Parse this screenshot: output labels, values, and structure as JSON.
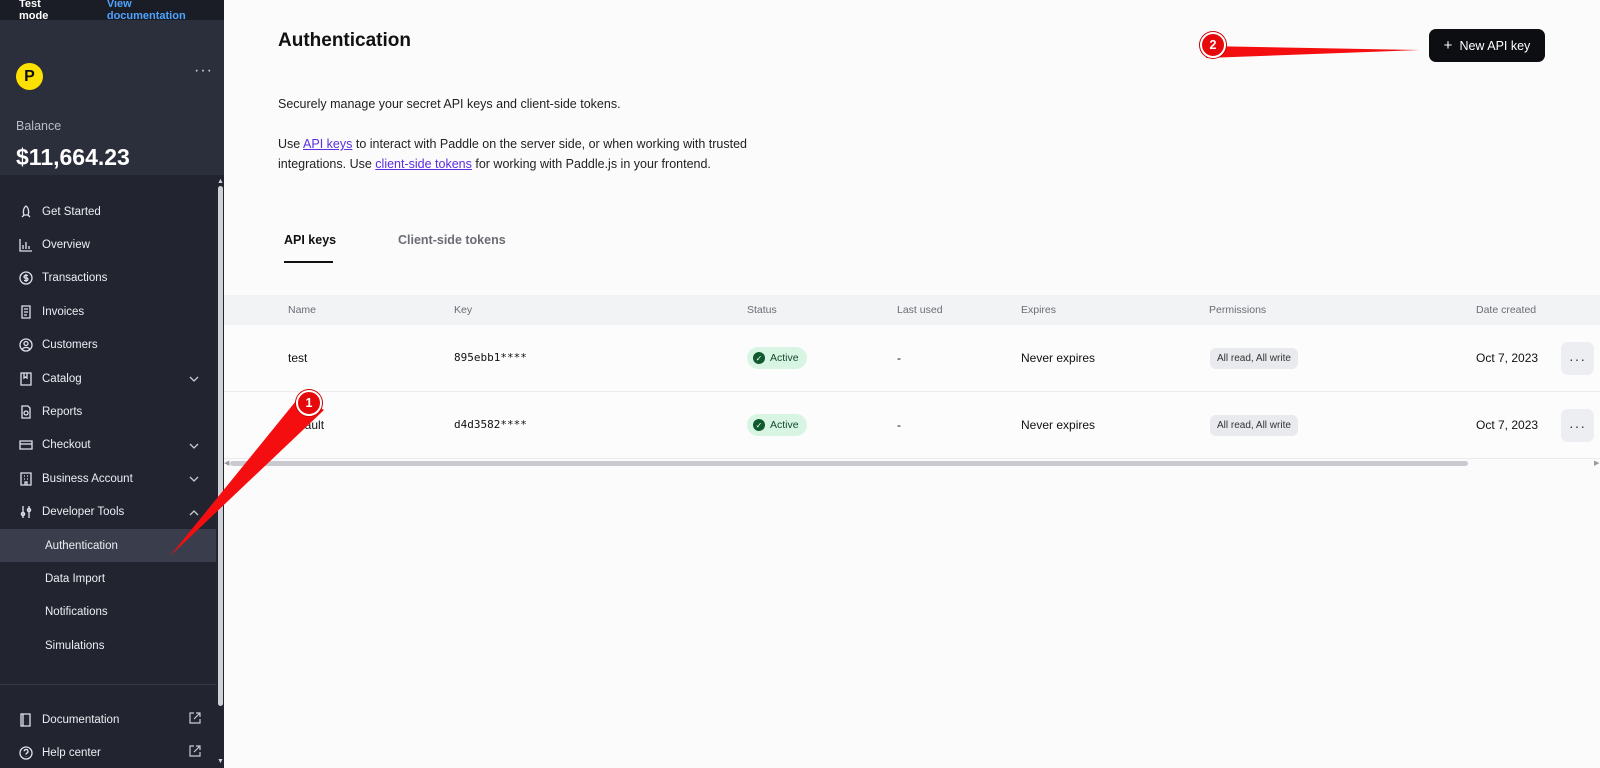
{
  "topbar": {
    "mode": "Test mode",
    "doc_link": "View documentation"
  },
  "brand": {
    "logo_letter": "P",
    "menu": "···",
    "balance_label": "Balance",
    "balance_value": "$11,664.23"
  },
  "sidebar": {
    "items": [
      {
        "label": "Get Started",
        "icon": "rocket-icon"
      },
      {
        "label": "Overview",
        "icon": "chart-icon"
      },
      {
        "label": "Transactions",
        "icon": "dollar-icon"
      },
      {
        "label": "Invoices",
        "icon": "invoice-icon"
      },
      {
        "label": "Customers",
        "icon": "user-icon"
      },
      {
        "label": "Catalog",
        "icon": "catalog-icon"
      },
      {
        "label": "Reports",
        "icon": "report-icon"
      },
      {
        "label": "Checkout",
        "icon": "card-icon"
      },
      {
        "label": "Business Account",
        "icon": "building-icon"
      },
      {
        "label": "Developer Tools",
        "icon": "sliders-icon"
      }
    ],
    "sub_items": [
      "Authentication",
      "Data Import",
      "Notifications",
      "Simulations"
    ],
    "bottom": [
      {
        "label": "Documentation",
        "icon": "book-icon"
      },
      {
        "label": "Help center",
        "icon": "help-icon"
      }
    ]
  },
  "main": {
    "title": "Authentication",
    "new_button": "New API key",
    "intro": "Securely manage your secret API keys and client-side tokens.",
    "para_use": "Use",
    "para_link1": "API keys",
    "para_mid": "to interact with Paddle on the server side, or when working with trusted",
    "para_line2_start": "integrations. Use",
    "para_link2": "client-side tokens",
    "para_end": "for working with Paddle.js in your frontend.",
    "tabs": [
      "API keys",
      "Client-side tokens"
    ],
    "table": {
      "headers": [
        "Name",
        "Key",
        "Status",
        "Last used",
        "Expires",
        "Permissions",
        "Date created"
      ],
      "rows": [
        {
          "name": "test",
          "key": "895ebb1****",
          "status": "Active",
          "last_used": "-",
          "expires": "Never expires",
          "permissions": "All read, All write",
          "date": "Oct 7, 2023"
        },
        {
          "name": "default",
          "key": "d4d3582****",
          "status": "Active",
          "last_used": "-",
          "expires": "Never expires",
          "permissions": "All read, All write",
          "date": "Oct 7, 2023"
        }
      ]
    }
  },
  "annotations": {
    "badge1": "1",
    "badge2": "2",
    "color": "#e5090c"
  }
}
